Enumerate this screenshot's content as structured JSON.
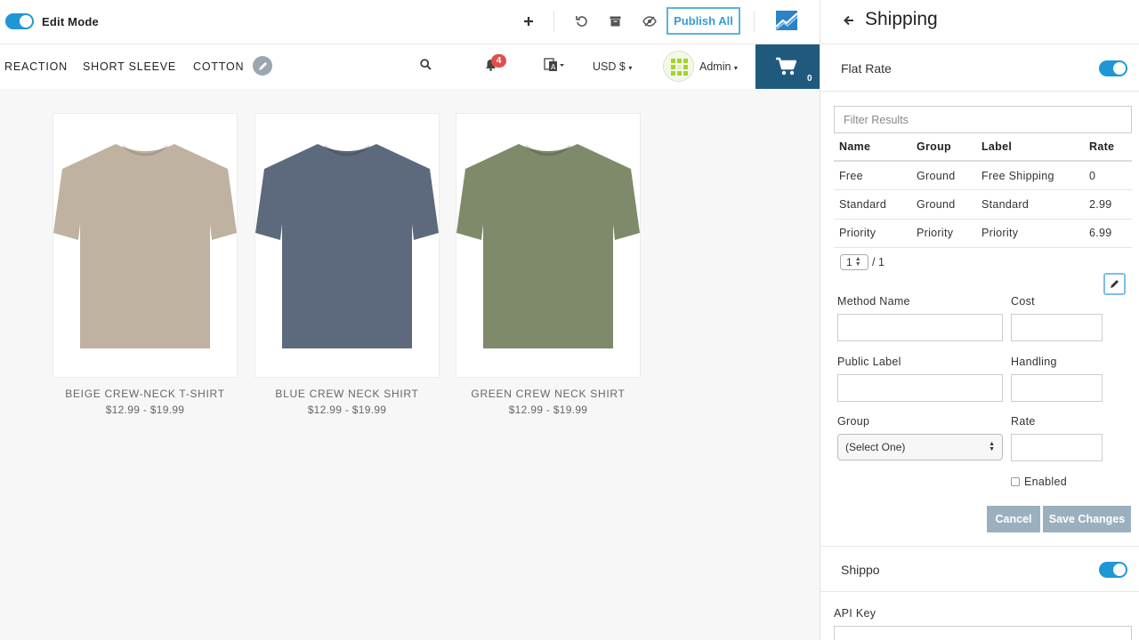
{
  "toolbar": {
    "edit_mode_label": "Edit Mode",
    "publish_label": "Publish All"
  },
  "nav": {
    "tags": [
      "REACTION",
      "SHORT SLEEVE",
      "COTTON"
    ],
    "notification_count": "4",
    "currency": "USD $",
    "user_label": "Admin",
    "cart_count": "0"
  },
  "products": [
    {
      "title": "BEIGE CREW-NECK T-SHIRT",
      "price": "$12.99 - $19.99",
      "color": "#c0b2a0"
    },
    {
      "title": "BLUE CREW NECK SHIRT",
      "price": "$12.99 - $19.99",
      "color": "#5d6a7d"
    },
    {
      "title": "GREEN CREW NECK SHIRT",
      "price": "$12.99 - $19.99",
      "color": "#7f8a6b"
    }
  ],
  "panel": {
    "title": "Shipping",
    "flat_rate": {
      "label": "Flat Rate",
      "filter_placeholder": "Filter Results",
      "columns": [
        "Name",
        "Group",
        "Label",
        "Rate"
      ],
      "rows": [
        [
          "Free",
          "Ground",
          "Free Shipping",
          "0"
        ],
        [
          "Standard",
          "Ground",
          "Standard",
          "2.99"
        ],
        [
          "Priority",
          "Priority",
          "Priority",
          "6.99"
        ]
      ],
      "page_current": "1",
      "page_total": "/ 1",
      "form": {
        "method_name_label": "Method Name",
        "cost_label": "Cost",
        "public_label_label": "Public Label",
        "handling_label": "Handling",
        "group_label": "Group",
        "group_value": "(Select One)",
        "rate_label": "Rate",
        "enabled_label": "Enabled",
        "cancel_label": "Cancel",
        "save_label": "Save Changes"
      }
    },
    "shippo": {
      "label": "Shippo",
      "api_key_label": "API Key"
    }
  },
  "colors": {
    "accent": "#1f97d4",
    "cart_bg": "#1f5a7e",
    "button_disabled": "#9bb0bf",
    "badge": "#e04e4e"
  }
}
